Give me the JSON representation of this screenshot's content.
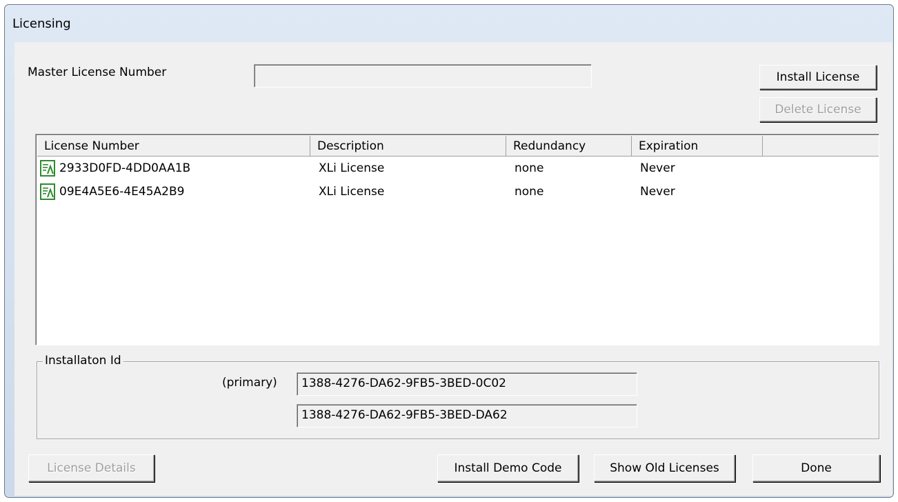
{
  "window": {
    "title": "Licensing"
  },
  "master": {
    "label": "Master License Number",
    "value": "",
    "install_button": "Install License",
    "delete_button": "Delete License"
  },
  "list": {
    "columns": [
      "License Number",
      "Description",
      "Redundancy",
      "Expiration",
      ""
    ],
    "rows": [
      {
        "number": "2933D0FD-4DD0AA1B",
        "description": "XLi License",
        "redundancy": "none",
        "expiration": "Never",
        "icon": "license-certificate-icon"
      },
      {
        "number": "09E4A5E6-4E45A2B9",
        "description": "XLi License",
        "redundancy": "none",
        "expiration": "Never",
        "icon": "license-certificate-icon"
      }
    ]
  },
  "installation": {
    "legend": "Installaton Id",
    "primary_label": "(primary)",
    "primary_id": "1388-4276-DA62-9FB5-3BED-0C02",
    "secondary_id": "1388-4276-DA62-9FB5-3BED-DA62"
  },
  "buttons": {
    "license_details": "License Details",
    "install_demo": "Install Demo Code",
    "show_old": "Show Old Licenses",
    "done": "Done"
  },
  "colors": {
    "icon_green": "#2e8b2e",
    "disabled_text": "#a0a0a0",
    "dialog_bg": "#f0f0f0"
  }
}
